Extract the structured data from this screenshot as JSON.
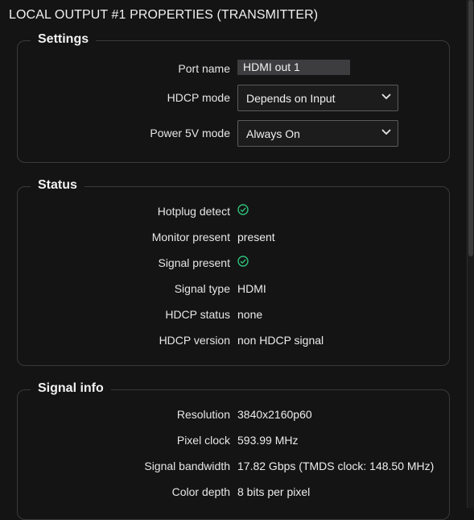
{
  "panel": {
    "title": "LOCAL OUTPUT #1 PROPERTIES (TRANSMITTER)"
  },
  "settings": {
    "legend": "Settings",
    "port_name": {
      "label": "Port name",
      "value": "HDMI out 1"
    },
    "hdcp_mode": {
      "label": "HDCP mode",
      "value": "Depends on Input"
    },
    "power_5v": {
      "label": "Power 5V mode",
      "value": "Always On"
    }
  },
  "status": {
    "legend": "Status",
    "hotplug": {
      "label": "Hotplug detect",
      "icon": "check-circle-icon"
    },
    "monitor": {
      "label": "Monitor present",
      "value": "present"
    },
    "signal_present": {
      "label": "Signal present",
      "icon": "check-circle-icon"
    },
    "signal_type": {
      "label": "Signal type",
      "value": "HDMI"
    },
    "hdcp_status": {
      "label": "HDCP status",
      "value": "none"
    },
    "hdcp_version": {
      "label": "HDCP version",
      "value": "non HDCP signal"
    }
  },
  "signal_info": {
    "legend": "Signal info",
    "resolution": {
      "label": "Resolution",
      "value": "3840x2160p60"
    },
    "pixel_clock": {
      "label": "Pixel clock",
      "value": "593.99 MHz"
    },
    "bandwidth": {
      "label": "Signal bandwidth",
      "value": "17.82 Gbps (TMDS clock: 148.50 MHz)"
    },
    "color_depth": {
      "label": "Color depth",
      "value": "8 bits per pixel"
    }
  },
  "colors": {
    "background": "#141414",
    "check": "#2fc07a",
    "border": "#3a3a3a"
  }
}
